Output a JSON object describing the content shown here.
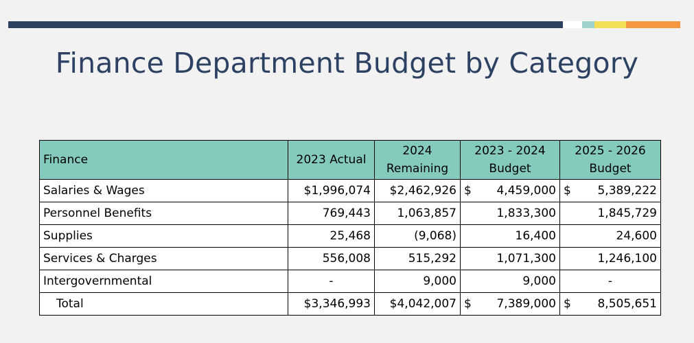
{
  "title": "Finance Department Budget by Category",
  "colors": {
    "navy": "#2d4263",
    "teal_header": "#84cbbd",
    "accent_teal": "#9fd2cc",
    "accent_yellow": "#f4de56",
    "accent_orange": "#f7963e"
  },
  "table": {
    "headers": [
      "Finance",
      "2023 Actual",
      "2024 Remaining",
      "2023 - 2024 Budget",
      "2025 - 2026 Budget"
    ],
    "header_lines": {
      "remaining_l1": "2024",
      "remaining_l2": "Remaining",
      "budget2324_l1": "2023 - 2024",
      "budget2324_l2": "Budget",
      "budget2526_l1": "2025 - 2026",
      "budget2526_l2": "Budget"
    },
    "currency_symbol": "$",
    "rows": [
      {
        "label": "Salaries & Wages",
        "actual_2023": "$1,996,074",
        "remaining_2024": "$2,462,926",
        "budget_2324": "4,459,000",
        "budget_2526": "5,389,222"
      },
      {
        "label": "Personnel Benefits",
        "actual_2023": "769,443",
        "remaining_2024": "1,063,857",
        "budget_2324": "1,833,300",
        "budget_2526": "1,845,729"
      },
      {
        "label": "Supplies",
        "actual_2023": "25,468",
        "remaining_2024": "(9,068)",
        "budget_2324": "16,400",
        "budget_2526": "24,600"
      },
      {
        "label": "Services & Charges",
        "actual_2023": "556,008",
        "remaining_2024": "515,292",
        "budget_2324": "1,071,300",
        "budget_2526": "1,246,100"
      },
      {
        "label": "Intergovernmental",
        "actual_2023": "-",
        "remaining_2024": "9,000",
        "budget_2324": "9,000",
        "budget_2526": "-"
      }
    ],
    "total": {
      "label": "Total",
      "actual_2023": "$3,346,993",
      "remaining_2024": "$4,042,007",
      "budget_2324": "7,389,000",
      "budget_2526": "8,505,651"
    }
  }
}
